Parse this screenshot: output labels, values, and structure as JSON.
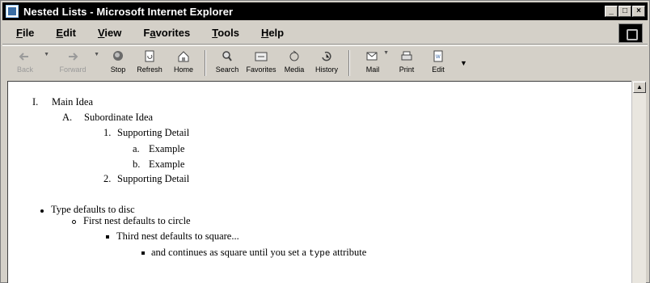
{
  "window": {
    "title": "Nested Lists - Microsoft Internet Explorer",
    "buttons": {
      "minimize": "_",
      "maximize": "□",
      "close": "×"
    }
  },
  "menu": [
    {
      "accel": "F",
      "rest": "ile"
    },
    {
      "accel": "E",
      "rest": "dit"
    },
    {
      "accel": "V",
      "rest": "iew"
    },
    {
      "pre": "F",
      "accel": "a",
      "rest": "vorites"
    },
    {
      "accel": "T",
      "rest": "ools"
    },
    {
      "accel": "H",
      "rest": "elp"
    }
  ],
  "toolbar": {
    "back": "Back",
    "forward": "Forward",
    "stop": "Stop",
    "refresh": "Refresh",
    "home": "Home",
    "search": "Search",
    "favorites": "Favorites",
    "media": "Media",
    "history": "History",
    "mail": "Mail",
    "print": "Print",
    "edit": "Edit"
  },
  "document": {
    "outline": {
      "roman_1": "I.",
      "main_idea": "Main Idea",
      "alpha_a": "A.",
      "subordinate_idea": "Subordinate Idea",
      "num_1": "1.",
      "supporting_detail_1": "Supporting Detail",
      "lower_a": "a.",
      "example_1": "Example",
      "lower_b": "b.",
      "example_2": "Example",
      "num_2": "2.",
      "supporting_detail_2": "Supporting Detail"
    },
    "bullets": {
      "disc_item": "Type defaults to disc",
      "circle_item": "First nest defaults to circle",
      "square_item": "Third nest defaults to square...",
      "square_item_2_pre": "and continues as square until you set a ",
      "square_item_2_code": "type",
      "square_item_2_post": " attribute"
    }
  }
}
